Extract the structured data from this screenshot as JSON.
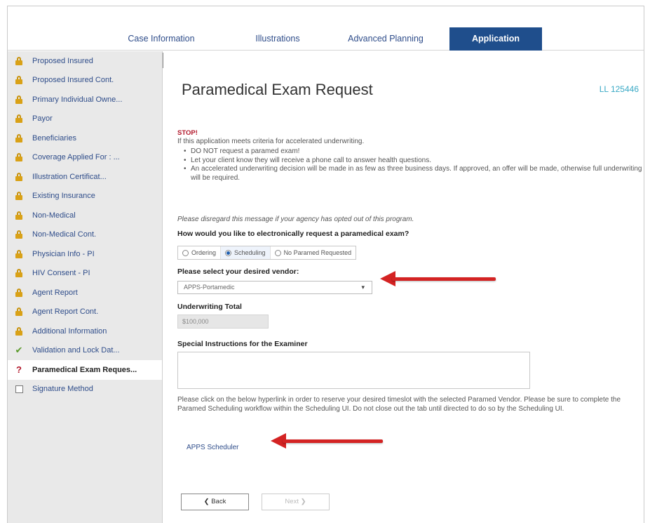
{
  "tabs": [
    "Case Information",
    "Illustrations",
    "Advanced Planning",
    "Application"
  ],
  "sidebar": {
    "items": [
      {
        "label": "Proposed Insured",
        "icon": "lock-icon"
      },
      {
        "label": "Proposed Insured Cont.",
        "icon": "lock-icon"
      },
      {
        "label": "Primary Individual Owne...",
        "icon": "lock-icon"
      },
      {
        "label": "Payor",
        "icon": "lock-icon"
      },
      {
        "label": "Beneficiaries",
        "icon": "lock-icon"
      },
      {
        "label": "Coverage Applied For : ...",
        "icon": "lock-icon"
      },
      {
        "label": "Illustration Certificat...",
        "icon": "lock-icon"
      },
      {
        "label": "Existing Insurance",
        "icon": "lock-icon"
      },
      {
        "label": "Non-Medical",
        "icon": "lock-icon"
      },
      {
        "label": "Non-Medical Cont.",
        "icon": "lock-icon"
      },
      {
        "label": "Physician Info - PI",
        "icon": "lock-icon"
      },
      {
        "label": "HIV Consent - PI",
        "icon": "lock-icon"
      },
      {
        "label": "Agent Report",
        "icon": "lock-icon"
      },
      {
        "label": "Agent Report Cont.",
        "icon": "lock-icon"
      },
      {
        "label": "Additional Information",
        "icon": "lock-icon"
      },
      {
        "label": "Validation and Lock Dat...",
        "icon": "checkmark-icon"
      },
      {
        "label": "Paramedical Exam Reques...",
        "icon": "question-icon"
      },
      {
        "label": "Signature Method",
        "icon": "checkbox-icon"
      }
    ]
  },
  "main": {
    "title": "Paramedical Exam Request",
    "case_id": "LL 125446",
    "stop_label": "STOP!",
    "stop_intro": "If this application meets criteria for accelerated underwriting.",
    "bullets": [
      "DO NOT request a paramed exam!",
      "Let your client know they will receive a phone call to answer health questions.",
      "An accelerated underwriting decision will be made in as few as three business days. If approved, an offer will be made, otherwise full underwriting will be required."
    ],
    "disregard": "Please disregard this message if your agency has opted out of this program.",
    "request_question": "How would you like to electronically request a paramedical exam?",
    "request_options": [
      "Ordering",
      "Scheduling",
      "No Paramed Requested"
    ],
    "request_selected": "Scheduling",
    "vendor_label": "Please select your desired vendor:",
    "vendor_value": "APPS-Portamedic",
    "uw_total_label": "Underwriting Total",
    "uw_total_value": "$100,000",
    "instructions_label": "Special Instructions for the Examiner",
    "instructions_value": "",
    "scheduler_note": "Please click on the below hyperlink in order to reserve your desired timeslot with the selected Paramed Vendor. Please be sure to complete the Paramed Scheduling workflow within the Scheduling UI. Do not close out the tab until directed to do so by the Scheduling UI.",
    "scheduler_link": "APPS Scheduler",
    "back_label": "❮ Back",
    "next_label": "Next ❯"
  },
  "colors": {
    "tab_active": "#1f4e8c",
    "link": "#2f4d8a",
    "stop": "#b2182b",
    "lock": "#d9a116",
    "check": "#5a9a2a",
    "case_id": "#39a9c5",
    "arrow": "#d42323"
  }
}
